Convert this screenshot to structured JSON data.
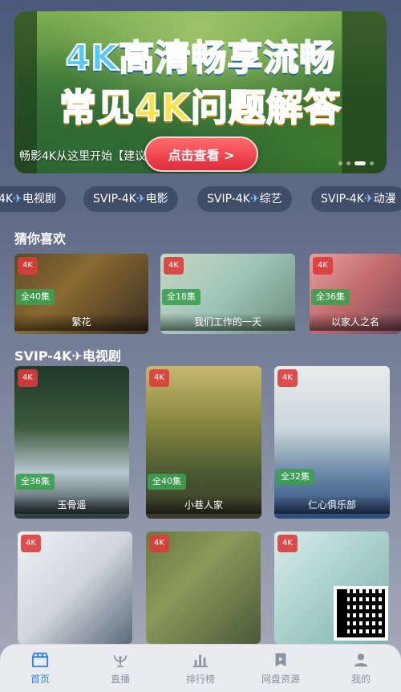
{
  "banner": {
    "line1": "4K高清畅享流畅",
    "line2": "常见4K问题解答",
    "caption": "畅影4K从这里开始【建议先",
    "button_label": "点击查看 >"
  },
  "chips": [
    {
      "label": "4K",
      "suffix": "电视剧"
    },
    {
      "label": "SVIP-4K",
      "suffix": "电影"
    },
    {
      "label": "SVIP-4K",
      "suffix": "综艺"
    },
    {
      "label": "SVIP-4K",
      "suffix": "动漫"
    }
  ],
  "sections": {
    "guess": "猜你喜欢",
    "tv": "SVIP-4K✈电视剧"
  },
  "guess_cards": [
    {
      "tag": "4K",
      "eps": "全40集",
      "name": "繁花"
    },
    {
      "tag": "4K",
      "eps": "全18集",
      "name": "我们工作的一天"
    },
    {
      "tag": "4K",
      "eps": "全36集",
      "name": "以家人之名"
    }
  ],
  "tv_cards": [
    {
      "tag": "4K",
      "eps": "全36集",
      "name": "玉骨遥"
    },
    {
      "tag": "4K",
      "eps": "全40集",
      "name": "小巷人家"
    },
    {
      "tag": "4K",
      "eps": "全32集",
      "name": "仁心俱乐部"
    },
    {
      "tag": "4K",
      "eps": "",
      "name": ""
    },
    {
      "tag": "4K",
      "eps": "",
      "name": ""
    },
    {
      "tag": "4K",
      "eps": "",
      "name": ""
    }
  ],
  "bottom_nav": [
    {
      "label": "首页",
      "icon": "clapperboard-icon",
      "active": true
    },
    {
      "label": "直播",
      "icon": "satellite-icon",
      "active": false
    },
    {
      "label": "排行榜",
      "icon": "bar-chart-icon",
      "active": false
    },
    {
      "label": "网盘资源",
      "icon": "play-tag-icon",
      "active": false
    },
    {
      "label": "我的",
      "icon": "user-icon",
      "active": false
    }
  ],
  "colors": {
    "accent": "#2f7fe0",
    "tag": "#dc3c3c",
    "eps": "#3ca050"
  }
}
